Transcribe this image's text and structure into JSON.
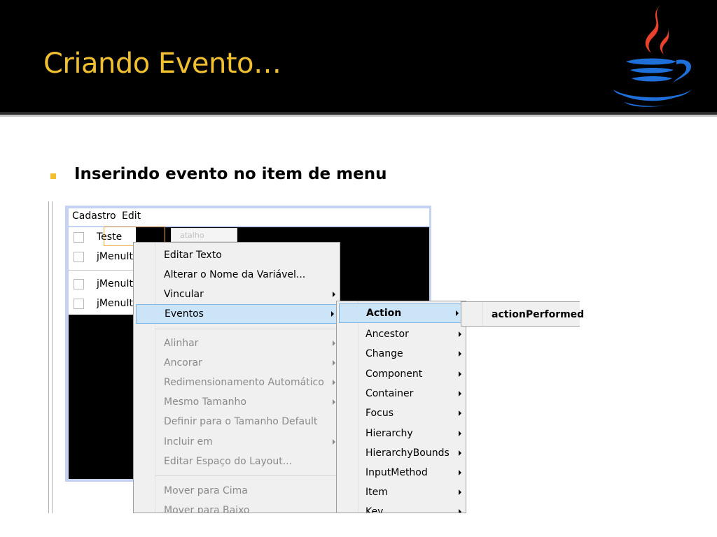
{
  "slide": {
    "title": "Criando Evento…",
    "bullet": "Inserindo evento no item de menu"
  },
  "form": {
    "menubar": [
      "Cadastro",
      "Edit"
    ],
    "menu_items": [
      "Teste",
      "jMenuIt",
      "jMenuIt",
      "jMenuIt"
    ],
    "shortcut_placeholder": "atalho"
  },
  "context_menu": [
    {
      "label": "Editar Texto",
      "enabled": true,
      "submenu": false
    },
    {
      "label": "Alterar o Nome da Variável...",
      "enabled": true,
      "submenu": false
    },
    {
      "label": "Vincular",
      "enabled": true,
      "submenu": true
    },
    {
      "label": "Eventos",
      "enabled": true,
      "submenu": true,
      "highlighted": true
    },
    {
      "label": "Alinhar",
      "enabled": false,
      "submenu": true
    },
    {
      "label": "Ancorar",
      "enabled": false,
      "submenu": true
    },
    {
      "label": "Redimensionamento Automático",
      "enabled": false,
      "submenu": true
    },
    {
      "label": "Mesmo Tamanho",
      "enabled": false,
      "submenu": true
    },
    {
      "label": "Definir para o Tamanho Default",
      "enabled": false,
      "submenu": false
    },
    {
      "label": "Incluir em",
      "enabled": false,
      "submenu": true
    },
    {
      "label": "Editar Espaço do Layout...",
      "enabled": false,
      "submenu": false
    },
    {
      "label": "Mover para Cima",
      "enabled": false,
      "submenu": false
    },
    {
      "label": "Mover para Baixo",
      "enabled": false,
      "submenu": false
    }
  ],
  "events_submenu": [
    {
      "label": "Action",
      "highlighted": true
    },
    {
      "label": "Ancestor"
    },
    {
      "label": "Change"
    },
    {
      "label": "Component"
    },
    {
      "label": "Container"
    },
    {
      "label": "Focus"
    },
    {
      "label": "Hierarchy"
    },
    {
      "label": "HierarchyBounds"
    },
    {
      "label": "InputMethod"
    },
    {
      "label": "Item"
    },
    {
      "label": "Key"
    }
  ],
  "action_submenu": [
    "actionPerformed"
  ],
  "colors": {
    "title": "#f0c030",
    "highlight": "#cce4f7",
    "header_bg": "#000000"
  },
  "icons": {
    "logo": "java-coffee-cup-icon",
    "submenu": "submenu-arrow-icon",
    "bullet": "square-bullet-icon"
  }
}
